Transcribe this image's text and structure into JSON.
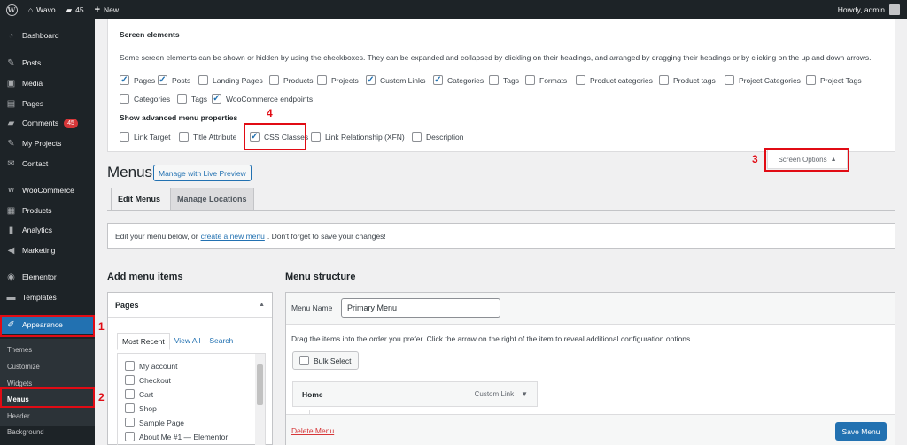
{
  "admin_bar": {
    "site_name": "Wavo",
    "comments_count": "45",
    "new_label": "New",
    "greeting": "Howdy, admin"
  },
  "sidebar": {
    "items": [
      {
        "label": "Dashboard",
        "icon": "gauge-icon"
      },
      {
        "label": "Posts",
        "icon": "pin-icon"
      },
      {
        "label": "Media",
        "icon": "media-icon"
      },
      {
        "label": "Pages",
        "icon": "page-icon"
      },
      {
        "label": "Comments",
        "icon": "comment-icon",
        "badge": "45"
      },
      {
        "label": "My Projects",
        "icon": "pin-icon"
      },
      {
        "label": "Contact",
        "icon": "mail-icon"
      },
      {
        "label": "WooCommerce",
        "icon": "woo-icon"
      },
      {
        "label": "Products",
        "icon": "archive-icon"
      },
      {
        "label": "Analytics",
        "icon": "bar-chart-icon"
      },
      {
        "label": "Marketing",
        "icon": "megaphone-icon"
      },
      {
        "label": "Elementor",
        "icon": "elementor-icon"
      },
      {
        "label": "Templates",
        "icon": "folder-icon"
      },
      {
        "label": "Appearance",
        "icon": "brush-icon"
      }
    ],
    "submenu": [
      "Themes",
      "Customize",
      "Widgets",
      "Menus",
      "Header",
      "Background"
    ]
  },
  "annotations": [
    "1",
    "2",
    "3",
    "4"
  ],
  "screen_options": {
    "title": "Screen elements",
    "description": "Some screen elements can be shown or hidden by using the checkboxes. They can be expanded and collapsed by clickling on their headings, and arranged by dragging their headings or by clicking on the up and down arrows.",
    "elements": [
      {
        "label": "Pages",
        "checked": true
      },
      {
        "label": "Posts",
        "checked": true
      },
      {
        "label": "Landing Pages",
        "checked": false
      },
      {
        "label": "Products",
        "checked": false
      },
      {
        "label": "Projects",
        "checked": false
      },
      {
        "label": "Custom Links",
        "checked": true
      },
      {
        "label": "Categories",
        "checked": true
      },
      {
        "label": "Tags",
        "checked": false
      },
      {
        "label": "Formats",
        "checked": false
      },
      {
        "label": "Product categories",
        "checked": false
      },
      {
        "label": "Product tags",
        "checked": false
      },
      {
        "label": "Project Categories",
        "checked": false
      },
      {
        "label": "Project Tags",
        "checked": false
      },
      {
        "label": "Categories",
        "checked": false
      },
      {
        "label": "Tags",
        "checked": false
      },
      {
        "label": "WooCommerce endpoints",
        "checked": true
      }
    ],
    "advanced_title": "Show advanced menu properties",
    "advanced": [
      {
        "label": "Link Target",
        "checked": false
      },
      {
        "label": "Title Attribute",
        "checked": false
      },
      {
        "label": "CSS Classes",
        "checked": true
      },
      {
        "label": "Link Relationship (XFN)",
        "checked": false
      },
      {
        "label": "Description",
        "checked": false
      }
    ],
    "tab_label": "Screen Options"
  },
  "main": {
    "title": "Menus",
    "live_preview_label": "Manage with Live Preview",
    "tabs": [
      "Edit Menus",
      "Manage Locations"
    ],
    "notice_before": "Edit your menu below, or",
    "notice_link": "create a new menu",
    "notice_after": ". Don't forget to save your changes!"
  },
  "add_items": {
    "heading": "Add menu items",
    "box_title": "Pages",
    "tabs": [
      "Most Recent",
      "View All",
      "Search"
    ],
    "pages": [
      "My account",
      "Checkout",
      "Cart",
      "Shop",
      "Sample Page",
      "About Me #1 — Elementor"
    ]
  },
  "structure": {
    "heading": "Menu structure",
    "menu_name_label": "Menu Name",
    "menu_name_value": "Primary Menu",
    "drag_hint": "Drag the items into the order you prefer. Click the arrow on the right of the item to reveal additional configuration options.",
    "bulk_select_label": "Bulk Select",
    "item_title": "Home",
    "item_type": "Custom Link",
    "delete_label": "Delete Menu",
    "save_label": "Save Menu"
  },
  "colors": {
    "admin_dark": "#1d2327",
    "accent": "#2271b1",
    "highlight": "#e10b14",
    "badge": "#d63638"
  }
}
